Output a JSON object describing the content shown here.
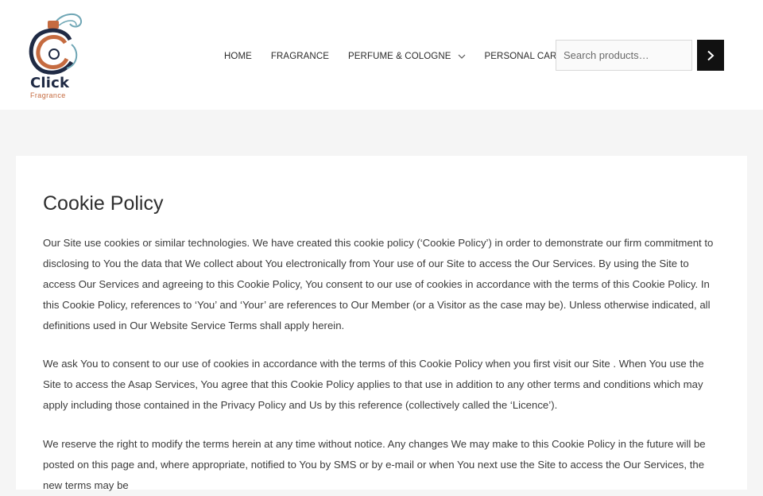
{
  "brand": {
    "name": "Click",
    "tagline": "Fragrance",
    "colors": {
      "navy": "#1f2a44",
      "copper": "#c56b40",
      "teal": "#6fa6b5"
    }
  },
  "nav": {
    "items": [
      {
        "label": "HOME",
        "has_dropdown": false
      },
      {
        "label": "FRAGRANCE",
        "has_dropdown": false
      },
      {
        "label": "PERFUME & COLOGNE",
        "has_dropdown": true
      },
      {
        "label": "PERSONAL CARE",
        "has_dropdown": true
      }
    ]
  },
  "search": {
    "placeholder": "Search products…",
    "value": "",
    "button_icon": "chevron-right-icon"
  },
  "page": {
    "title": "Cookie Policy",
    "paragraphs": [
      "Our Site use cookies or similar technologies. We have created this cookie policy (‘Cookie Policy’) in order to demonstrate our firm commitment to disclosing to You the data that We collect about You electronically from Your use of our Site to access the Our Services. By using the Site to access Our Services and agreeing to this Cookie Policy, You consent to our use of cookies in accordance with the terms of this Cookie Policy. In this Cookie Policy, references to ‘You’ and ‘Your’ are references to Our Member (or a Visitor as the case may be). Unless otherwise indicated, all definitions used in Our Website Service Terms shall apply herein.",
      "We ask You to consent to our use of cookies in accordance with the terms of this Cookie Policy when you first visit our Site . When You use the Site to access the Asap Services, You agree that this Cookie Policy applies to that use in addition to any other terms and conditions which may apply including those contained in the Privacy Policy and Us by this reference (collectively called the ‘Licence’).",
      "We reserve the right to modify the terms herein at any time without notice. Any changes We may make to this Cookie Policy in the future will be posted on this page and, where appropriate, notified to You by SMS or by e-mail or when You next use the Site to access the Our Services, the new terms may be"
    ]
  }
}
